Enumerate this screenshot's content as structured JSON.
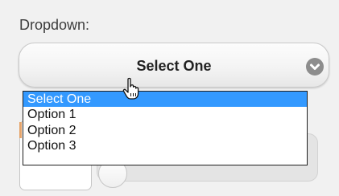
{
  "label": "Dropdown:",
  "select": {
    "value": "Select One",
    "icon": "chevron-down-icon"
  },
  "options": [
    {
      "label": "Select One",
      "selected": true
    },
    {
      "label": "Option 1",
      "selected": false
    },
    {
      "label": "Option 2",
      "selected": false
    },
    {
      "label": "Option 3",
      "selected": false
    }
  ],
  "colors": {
    "highlight": "#3399ff",
    "background": "#f1f1f1",
    "chevron_circle": "#8d8d8d"
  },
  "cursor": "hand-pointer-icon"
}
